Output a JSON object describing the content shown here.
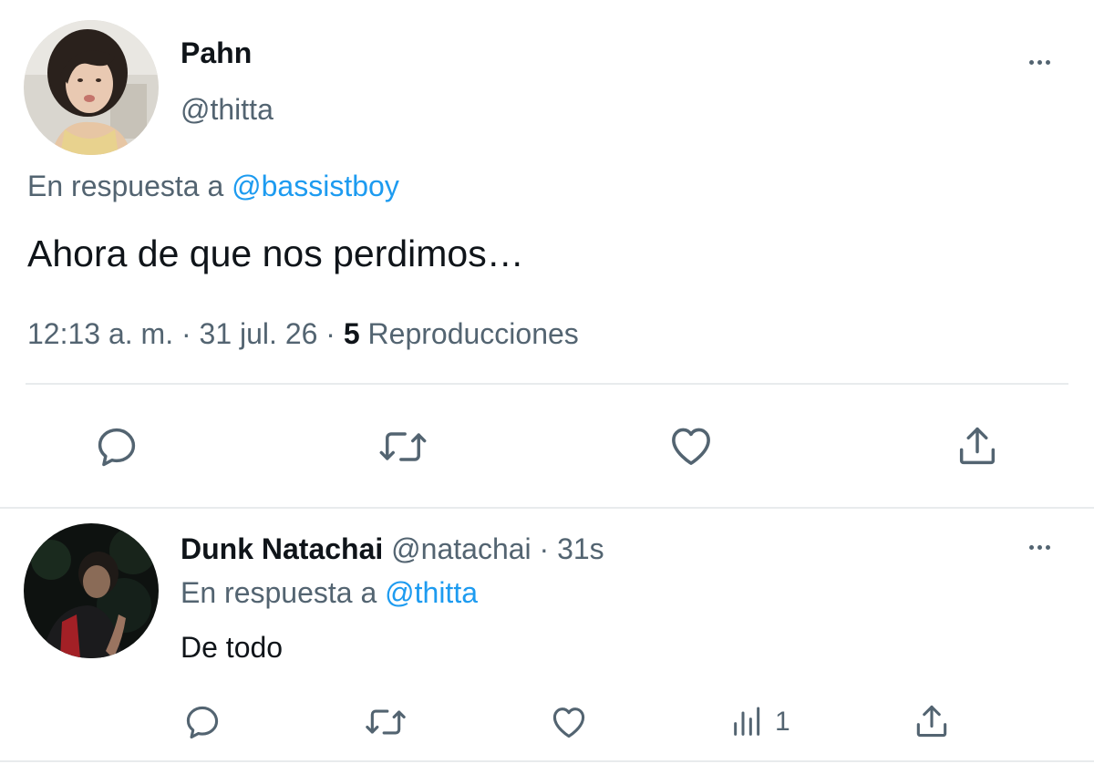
{
  "main_tweet": {
    "author_name": "Pahn",
    "handle": "@thitta",
    "reply_prefix": "En respuesta a",
    "reply_to": "@bassistboy",
    "text": "Ahora de que nos perdimos…",
    "time": "12:13 a. m.",
    "separator": "·",
    "date": "31 jul. 26",
    "views_count": "5",
    "views_label": "Reproducciones",
    "actions": [
      "reply-icon",
      "retweet-icon",
      "like-icon",
      "share-icon"
    ]
  },
  "reply_tweet": {
    "author_name": "Dunk Natachai",
    "handle": "@natachai",
    "separator": "·",
    "age": "31s",
    "reply_prefix": "En respuesta a",
    "reply_to": "@thitta",
    "text": "De todo",
    "views_count": "1",
    "actions": [
      "reply-icon",
      "retweet-icon",
      "like-icon",
      "views-icon",
      "share-icon"
    ]
  },
  "colors": {
    "text": "#0f1419",
    "muted": "#536471",
    "link": "#1d9bf0",
    "divider": "#e8ebed"
  }
}
